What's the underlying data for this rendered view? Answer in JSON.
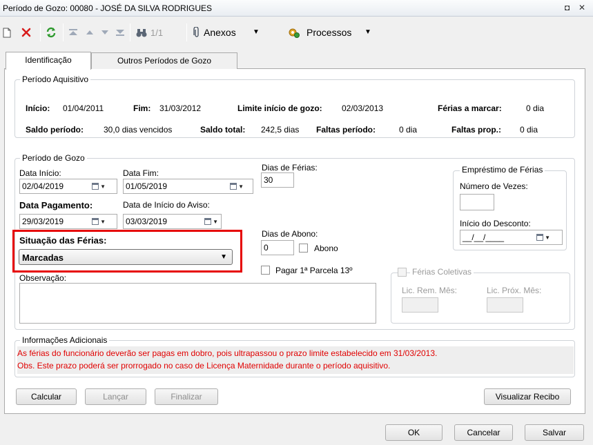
{
  "window": {
    "title": "Período de Gozo: 00080 - JOSÉ DA SILVA RODRIGUES",
    "restore_glyph": "◘",
    "close_glyph": "✕"
  },
  "toolbar": {
    "record_position": "1/1",
    "attachments_label": "Anexos",
    "processes_label": "Processos",
    "icons": [
      "new-document-icon",
      "delete-icon",
      "refresh-icon",
      "first-record-icon",
      "previous-record-icon",
      "next-record-icon",
      "last-record-icon",
      "binoculars-icon",
      "paperclip-icon",
      "processes-icon"
    ]
  },
  "tabs": [
    {
      "label": "Identificação",
      "active": true
    },
    {
      "label": "Outros Períodos de Gozo",
      "active": false
    }
  ],
  "acquisition": {
    "title": "Período Aquisitivo",
    "start_label": "Início:",
    "start_value": "01/04/2011",
    "end_label": "Fim:",
    "end_value": "31/03/2012",
    "limit_label": "Limite início de gozo:",
    "limit_value": "02/03/2013",
    "to_schedule_label": "Férias a marcar:",
    "to_schedule_value": "0 dia",
    "period_balance_label": "Saldo período:",
    "period_balance_value": "30,0 dias vencidos",
    "total_balance_label": "Saldo total:",
    "total_balance_value": "242,5 dias",
    "absences_label": "Faltas período:",
    "absences_value": "0 dia",
    "absences_prop_label": "Faltas prop.:",
    "absences_prop_value": "0 dia"
  },
  "enjoyment": {
    "title": "Período de Gozo",
    "start_date_label": "Data Início:",
    "start_date_value": "02/04/2019",
    "end_date_label": "Data Fim:",
    "end_date_value": "01/05/2019",
    "days_label": "Dias de Férias:",
    "days_value": "30",
    "payment_date_label": "Data Pagamento:",
    "payment_date_value": "29/03/2019",
    "notice_date_label": "Data de Início do Aviso:",
    "notice_date_value": "03/03/2019",
    "bonus_days_label": "Dias de Abono:",
    "bonus_days_value": "0",
    "bonus_checkbox_label": "Abono",
    "pay13_checkbox_label": "Pagar 1ª Parcela 13º",
    "status_label": "Situação das Férias:",
    "status_value": "Marcadas",
    "notes_label": "Observação:",
    "loan": {
      "title": "Empréstimo de Férias",
      "times_label": "Número de Vezes:",
      "discount_start_label": "Início do Desconto:",
      "discount_start_value": "__/__/____"
    },
    "collective": {
      "label": "Férias Coletivas",
      "rem_label": "Lic. Rem. Mês:",
      "next_label": "Lic. Próx. Mês:"
    }
  },
  "additional": {
    "title": "Informações Adicionais",
    "line1": "As férias do funcionário deverão ser pagas em dobro, pois ultrapassou o prazo limite estabelecido em 31/03/2013.",
    "line2": "Obs. Este prazo poderá ser prorrogado no caso de Licença Maternidade durante o período aquisitivo.",
    "text_color": "#e00000"
  },
  "actions": {
    "calculate": "Calcular",
    "post": "Lançar",
    "finish": "Finalizar",
    "view_receipt": "Visualizar Recibo"
  },
  "dialog": {
    "ok": "OK",
    "cancel": "Cancelar",
    "save": "Salvar"
  },
  "highlight_color": "#e60000"
}
